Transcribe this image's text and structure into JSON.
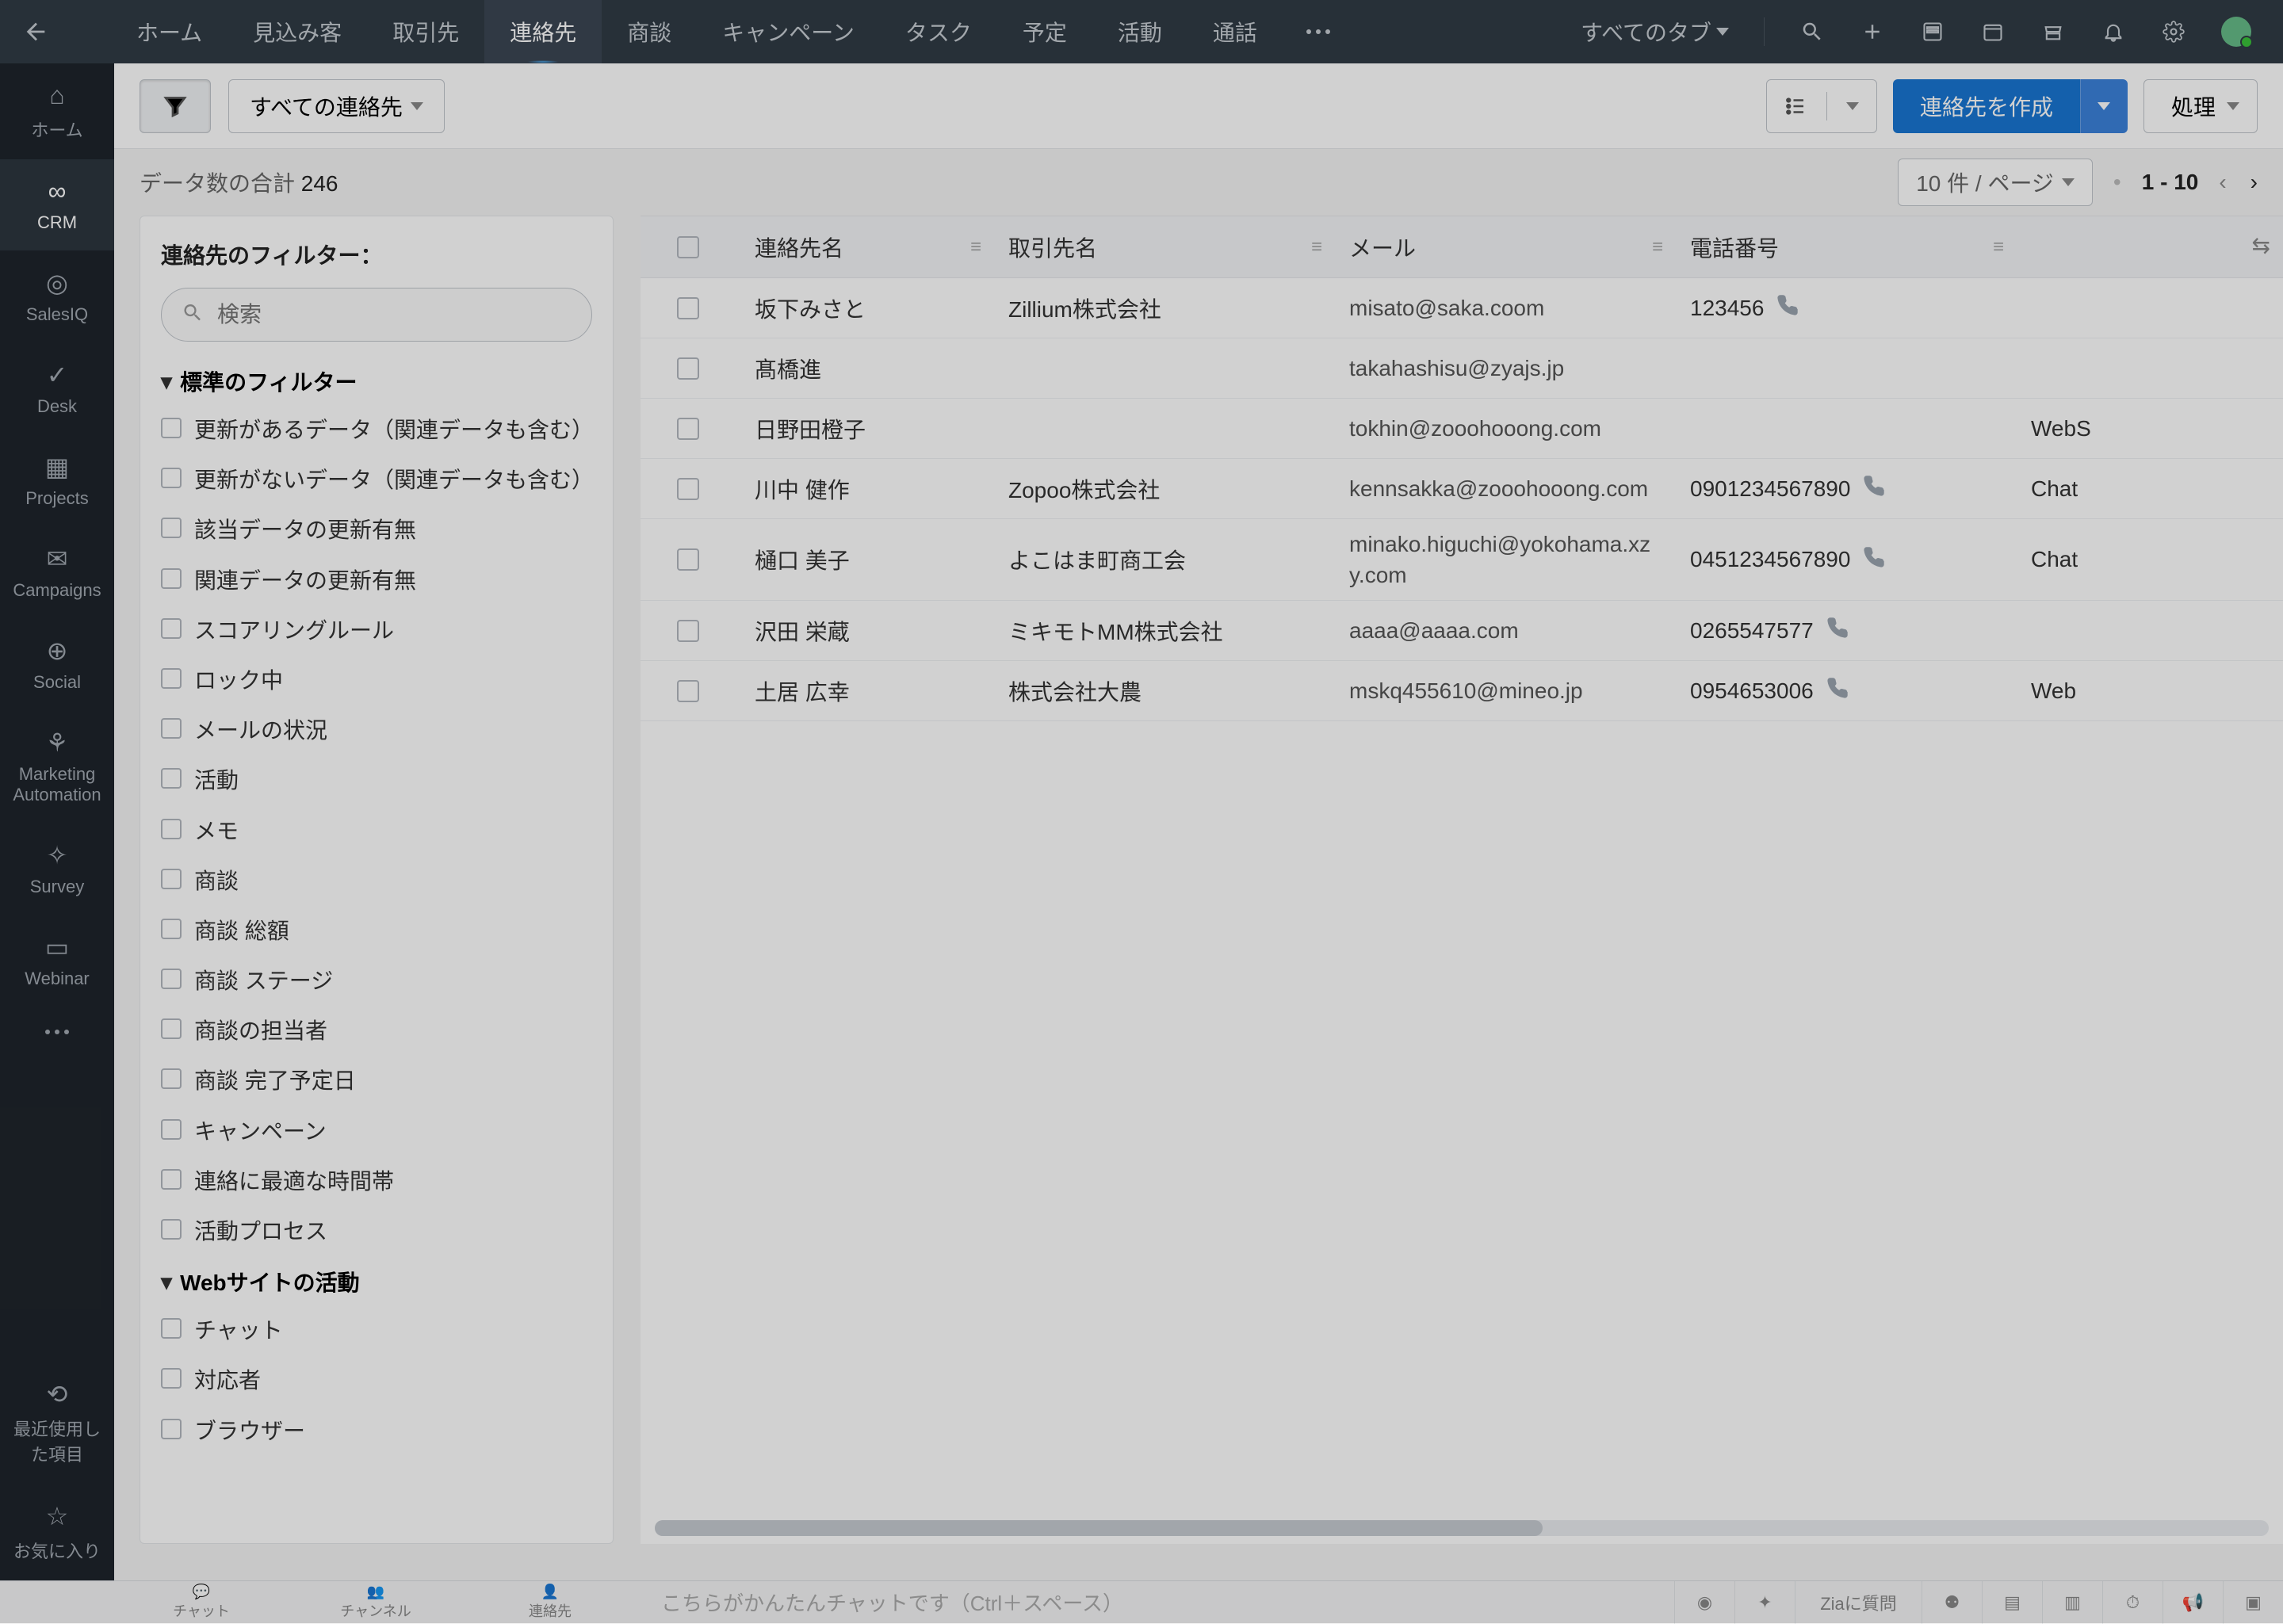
{
  "top": {
    "tabs": [
      "ホーム",
      "見込み客",
      "取引先",
      "連絡先",
      "商談",
      "キャンペーン",
      "タスク",
      "予定",
      "活動",
      "通話"
    ],
    "active_tab": "連絡先",
    "all_tabs_label": "すべてのタブ"
  },
  "leftnav": {
    "items": [
      {
        "icon": "home",
        "label": "ホーム"
      },
      {
        "icon": "crm",
        "label": "CRM",
        "active": true
      },
      {
        "icon": "salesiq",
        "label": "SalesIQ"
      },
      {
        "icon": "desk",
        "label": "Desk"
      },
      {
        "icon": "projects",
        "label": "Projects"
      },
      {
        "icon": "campaigns",
        "label": "Campaigns"
      },
      {
        "icon": "social",
        "label": "Social"
      },
      {
        "icon": "marketing",
        "label": "Marketing Automation"
      },
      {
        "icon": "survey",
        "label": "Survey"
      },
      {
        "icon": "webinar",
        "label": "Webinar"
      }
    ],
    "recent_label": "最近使用した項目",
    "fav_label": "お気に入り"
  },
  "toolbar": {
    "view_label": "すべての連絡先",
    "create_label": "連絡先を作成",
    "process_label": "処理"
  },
  "datarow": {
    "total_prefix": "データ数の合計 ",
    "total_count": "246",
    "page_size_label": "10 件 / ページ",
    "range": "1 - 10"
  },
  "filters": {
    "title": "連絡先のフィルター：",
    "search_placeholder": "検索",
    "section_std": "標準のフィルター",
    "std_items": [
      "更新があるデータ（関連データも含む）",
      "更新がないデータ（関連データも含む）",
      "該当データの更新有無",
      "関連データの更新有無",
      "スコアリングルール",
      "ロック中",
      "メールの状況",
      "活動",
      "メモ",
      "商談",
      "商談 総額",
      "商談 ステージ",
      "商談の担当者",
      "商談 完了予定日",
      "キャンペーン",
      "連絡に最適な時間帯",
      "活動プロセス"
    ],
    "section_web": "Webサイトの活動",
    "web_items": [
      "チャット",
      "対応者",
      "ブラウザー"
    ]
  },
  "table": {
    "columns": [
      "連絡先名",
      "取引先名",
      "メール",
      "電話番号"
    ],
    "rows": [
      {
        "name": "坂下みさと",
        "acct": "Zillium株式会社",
        "email": "misato@saka.coom",
        "phone": "123456",
        "src": ""
      },
      {
        "name": "髙橋進",
        "acct": "",
        "email": "takahashisu@zyajs.jp",
        "phone": "",
        "src": ""
      },
      {
        "name": "日野田橙子",
        "acct": "",
        "email": "tokhin@zooohooong.com",
        "phone": "",
        "src": "WebS"
      },
      {
        "name": "川中 健作",
        "acct": "Zopoo株式会社",
        "email": "kennsakka@zooohooong.com",
        "phone": "0901234567890",
        "src": "Chat"
      },
      {
        "name": "樋口 美子",
        "acct": "よこはま町商工会",
        "email": "minako.higuchi@yokohama.xzy.com",
        "phone": "0451234567890",
        "src": "Chat"
      },
      {
        "name": "沢田 栄蔵",
        "acct": "ミキモトMM株式会社",
        "email": "aaaa@aaaa.com",
        "phone": "0265547577",
        "src": ""
      },
      {
        "name": "土居 広幸",
        "acct": "株式会社大農",
        "email": "mskq455610@mineo.jp",
        "phone": "0954653006",
        "src": "Web"
      }
    ]
  },
  "bottom": {
    "tabs": [
      "チャット",
      "チャンネル",
      "連絡先"
    ],
    "placeholder": "こちらがかんたんチャットです（Ctrl＋スペース）",
    "zia": "Ziaに質問"
  }
}
